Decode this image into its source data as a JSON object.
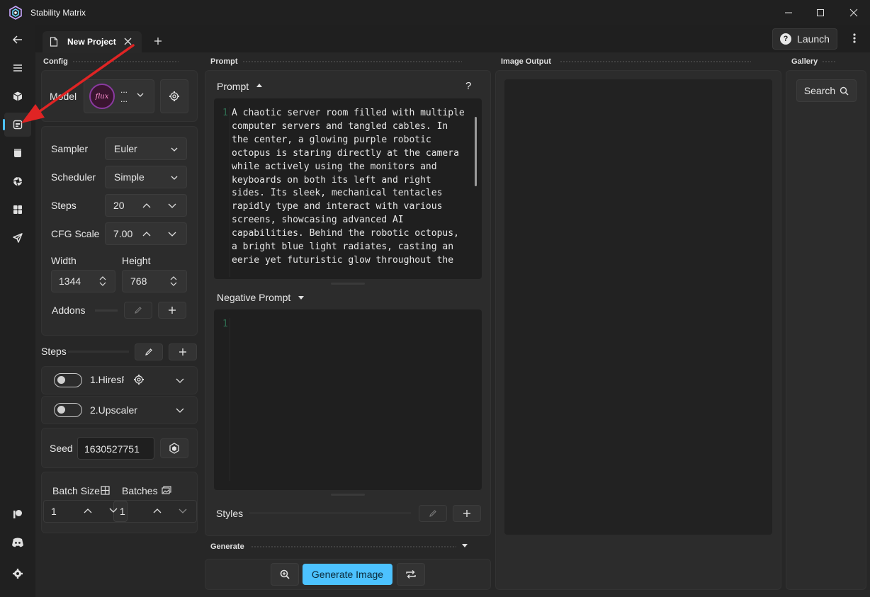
{
  "app": {
    "title": "Stability Matrix"
  },
  "tabs": [
    {
      "label": "New Project"
    }
  ],
  "header": {
    "launch_label": "Launch"
  },
  "panels": {
    "config": "Config",
    "prompt": "Prompt",
    "image_output": "Image Output",
    "gallery": "Gallery",
    "generate": "Generate"
  },
  "model": {
    "label": "Model",
    "name_line1": "...",
    "name_line2": "...",
    "logo_text": "flux"
  },
  "sampler": {
    "label": "Sampler",
    "value": "Euler"
  },
  "scheduler": {
    "label": "Scheduler",
    "value": "Simple"
  },
  "steps_field": {
    "label": "Steps",
    "value": "20"
  },
  "cfg": {
    "label": "CFG Scale",
    "value": "7.00"
  },
  "width": {
    "label": "Width",
    "value": "1344"
  },
  "height": {
    "label": "Height",
    "value": "768"
  },
  "addons": {
    "label": "Addons"
  },
  "steps_section": {
    "label": "Steps",
    "items": [
      {
        "label": "1.HiresF"
      },
      {
        "label": "2.Upscaler"
      }
    ]
  },
  "seed": {
    "label": "Seed",
    "value": "1630527751"
  },
  "batch": {
    "size_label": "Batch Size",
    "batches_label": "Batches",
    "size_value": "1",
    "batches_value": "1"
  },
  "prompt": {
    "header": "Prompt",
    "help": "?",
    "line_number": "1",
    "lines": [
      "A chaotic server room filled with multiple",
      "computer servers and tangled cables. In",
      "the center, a glowing purple robotic",
      "octopus is staring directly at the camera",
      "while actively using the monitors and",
      "keyboards on both its left and right",
      "sides. Its sleek, mechanical tentacles",
      "rapidly type and interact with various",
      "screens, showcasing advanced AI",
      "capabilities. Behind the robotic octopus,",
      "a bright blue light radiates, casting an",
      "eerie yet futuristic glow throughout the"
    ]
  },
  "negative_prompt": {
    "header": "Negative Prompt",
    "line_number": "1"
  },
  "styles": {
    "label": "Styles"
  },
  "generate": {
    "button_label": "Generate Image"
  },
  "gallery": {
    "search_label": "Search"
  },
  "colors": {
    "accent": "#4cc2ff",
    "arrow": "#e02424",
    "primary_button": "#4cc2ff"
  }
}
